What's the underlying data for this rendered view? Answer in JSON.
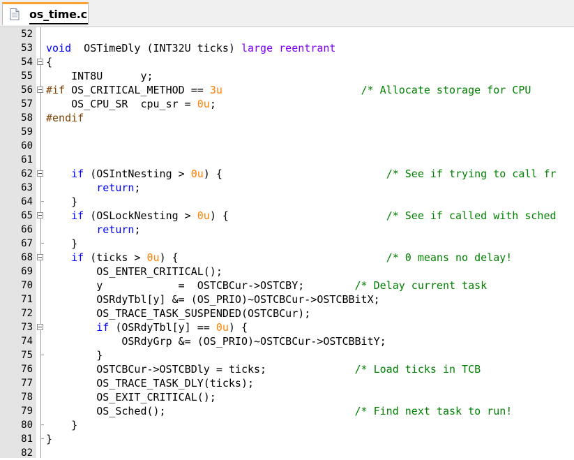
{
  "tab": {
    "label": "os_time.c",
    "icon": "document-icon",
    "accent_color": "#f8a030"
  },
  "lines": [
    {
      "n": "52",
      "fold": "line",
      "tokens": []
    },
    {
      "n": "53",
      "fold": "",
      "tokens": [
        [
          "kw",
          "void"
        ],
        [
          "",
          "  OSTimeDly (INT32U ticks) "
        ],
        [
          "ext",
          "large reentrant"
        ]
      ]
    },
    {
      "n": "54",
      "fold": "box",
      "tokens": [
        [
          "",
          "{"
        ]
      ]
    },
    {
      "n": "55",
      "fold": "line",
      "tokens": [
        [
          "",
          "    INT8U      y;"
        ]
      ]
    },
    {
      "n": "56",
      "fold": "box",
      "tokens": [
        [
          "pp",
          "#if"
        ],
        [
          "",
          " OS_CRITICAL_METHOD == "
        ],
        [
          "num",
          "3u"
        ],
        [
          "",
          "                      "
        ],
        [
          "cm",
          "/* Allocate storage for CPU"
        ]
      ]
    },
    {
      "n": "57",
      "fold": "line",
      "tokens": [
        [
          "",
          "    OS_CPU_SR  cpu_sr = "
        ],
        [
          "num",
          "0u"
        ],
        [
          "",
          ";"
        ]
      ]
    },
    {
      "n": "58",
      "fold": "line",
      "tokens": [
        [
          "pp",
          "#endif"
        ]
      ]
    },
    {
      "n": "59",
      "fold": "line",
      "tokens": []
    },
    {
      "n": "60",
      "fold": "line",
      "tokens": []
    },
    {
      "n": "61",
      "fold": "line",
      "tokens": []
    },
    {
      "n": "62",
      "fold": "box",
      "tokens": [
        [
          "",
          "    "
        ],
        [
          "kw",
          "if"
        ],
        [
          "",
          " (OSIntNesting > "
        ],
        [
          "num",
          "0u"
        ],
        [
          "",
          ") {                          "
        ],
        [
          "cm",
          "/* See if trying to call fr"
        ]
      ]
    },
    {
      "n": "63",
      "fold": "line",
      "tokens": [
        [
          "",
          "        "
        ],
        [
          "kw",
          "return"
        ],
        [
          "",
          ";"
        ]
      ]
    },
    {
      "n": "64",
      "fold": "end",
      "tokens": [
        [
          "",
          "    }"
        ]
      ]
    },
    {
      "n": "65",
      "fold": "box",
      "tokens": [
        [
          "",
          "    "
        ],
        [
          "kw",
          "if"
        ],
        [
          "",
          " (OSLockNesting > "
        ],
        [
          "num",
          "0u"
        ],
        [
          "",
          ") {                         "
        ],
        [
          "cm",
          "/* See if called with sched"
        ]
      ]
    },
    {
      "n": "66",
      "fold": "line",
      "tokens": [
        [
          "",
          "        "
        ],
        [
          "kw",
          "return"
        ],
        [
          "",
          ";"
        ]
      ]
    },
    {
      "n": "67",
      "fold": "end",
      "tokens": [
        [
          "",
          "    }"
        ]
      ]
    },
    {
      "n": "68",
      "fold": "box",
      "tokens": [
        [
          "",
          "    "
        ],
        [
          "kw",
          "if"
        ],
        [
          "",
          " (ticks > "
        ],
        [
          "num",
          "0u"
        ],
        [
          "",
          ") {                                 "
        ],
        [
          "cm",
          "/* 0 means no delay!"
        ]
      ]
    },
    {
      "n": "69",
      "fold": "line",
      "tokens": [
        [
          "",
          "        OS_ENTER_CRITICAL();"
        ]
      ]
    },
    {
      "n": "70",
      "fold": "line",
      "tokens": [
        [
          "",
          "        y            =  OSTCBCur->OSTCBY;        "
        ],
        [
          "cm",
          "/* Delay current task"
        ]
      ]
    },
    {
      "n": "71",
      "fold": "line",
      "tokens": [
        [
          "",
          "        OSRdyTbl[y] &= (OS_PRIO)~OSTCBCur->OSTCBBitX;"
        ]
      ]
    },
    {
      "n": "72",
      "fold": "line",
      "tokens": [
        [
          "",
          "        OS_TRACE_TASK_SUSPENDED(OSTCBCur);"
        ]
      ]
    },
    {
      "n": "73",
      "fold": "box",
      "tokens": [
        [
          "",
          "        "
        ],
        [
          "kw",
          "if"
        ],
        [
          "",
          " (OSRdyTbl[y] == "
        ],
        [
          "num",
          "0u"
        ],
        [
          "",
          ") {"
        ]
      ]
    },
    {
      "n": "74",
      "fold": "line",
      "tokens": [
        [
          "",
          "            OSRdyGrp &= (OS_PRIO)~OSTCBCur->OSTCBBitY;"
        ]
      ]
    },
    {
      "n": "75",
      "fold": "end",
      "tokens": [
        [
          "",
          "        }"
        ]
      ]
    },
    {
      "n": "76",
      "fold": "line",
      "tokens": [
        [
          "",
          "        OSTCBCur->OSTCBDly = ticks;              "
        ],
        [
          "cm",
          "/* Load ticks in TCB"
        ]
      ]
    },
    {
      "n": "77",
      "fold": "line",
      "tokens": [
        [
          "",
          "        OS_TRACE_TASK_DLY(ticks);"
        ]
      ]
    },
    {
      "n": "78",
      "fold": "line",
      "tokens": [
        [
          "",
          "        OS_EXIT_CRITICAL();"
        ]
      ]
    },
    {
      "n": "79",
      "fold": "line",
      "tokens": [
        [
          "",
          "        OS_Sched();                              "
        ],
        [
          "cm",
          "/* Find next task to run!"
        ]
      ]
    },
    {
      "n": "80",
      "fold": "end",
      "tokens": [
        [
          "",
          "    }"
        ]
      ]
    },
    {
      "n": "81",
      "fold": "end",
      "tokens": [
        [
          "",
          "}"
        ]
      ]
    },
    {
      "n": "82",
      "fold": "",
      "tokens": []
    }
  ]
}
